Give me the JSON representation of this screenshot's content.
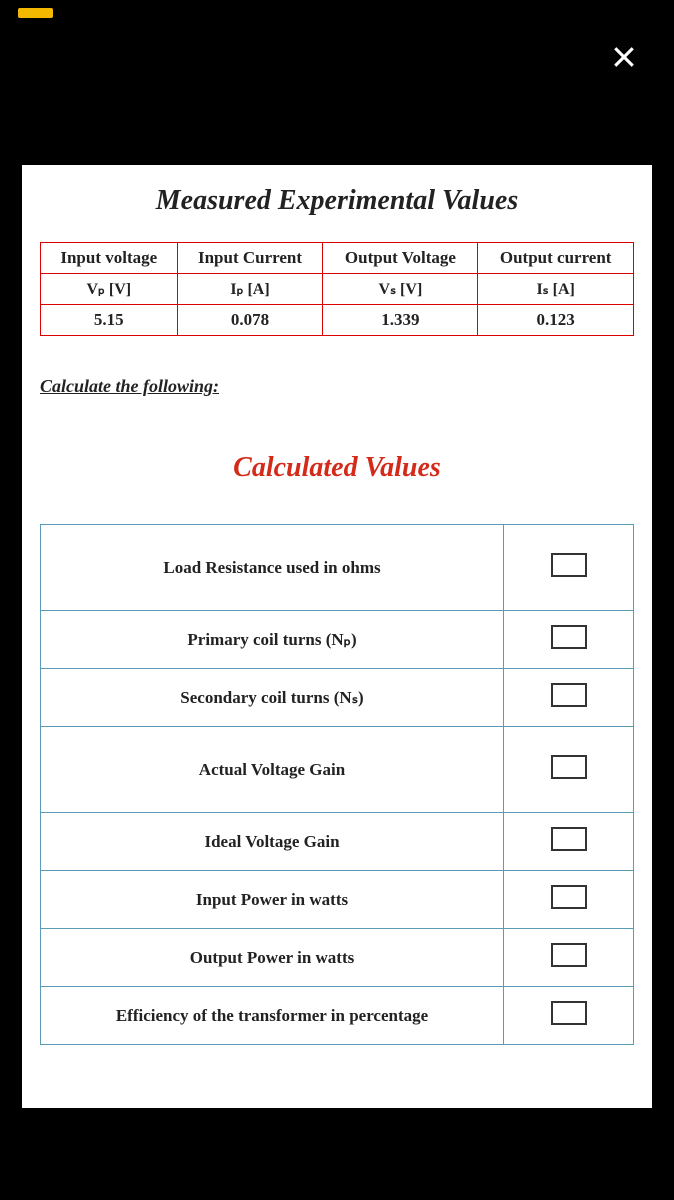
{
  "statusbar": {},
  "close": {
    "label": "close"
  },
  "measured": {
    "title": "Measured Experimental Values",
    "headers": [
      "Input voltage",
      "Input Current",
      "Output Voltage",
      "Output current"
    ],
    "subheaders_text": [
      "Vₚ  [V]",
      "Iₚ [A]",
      "Vₛ  [V]",
      "Iₛ [A]"
    ],
    "values": [
      "5.15",
      "0.078",
      "1.339",
      "0.123"
    ]
  },
  "calculate_label": "Calculate the following:",
  "calculated": {
    "title": "Calculated Values",
    "rows": [
      {
        "label": "Load Resistance used in ohms",
        "tall": true
      },
      {
        "label": "Primary coil turns (Nₚ)",
        "tall": false
      },
      {
        "label": "Secondary coil turns (Nₛ)",
        "tall": false
      },
      {
        "label": "Actual Voltage Gain",
        "tall": true
      },
      {
        "label": "Ideal Voltage Gain",
        "tall": false
      },
      {
        "label": "Input Power in watts",
        "tall": false
      },
      {
        "label": "Output Power in watts",
        "tall": false
      },
      {
        "label": "Efficiency of the transformer in percentage",
        "tall": false
      }
    ]
  },
  "chart_data": {
    "type": "table",
    "title": "Measured Experimental Values",
    "columns": [
      "Input voltage Vₚ [V]",
      "Input Current Iₚ [A]",
      "Output Voltage Vₛ [V]",
      "Output current Iₛ [A]"
    ],
    "rows": [
      [
        5.15,
        0.078,
        1.339,
        0.123
      ]
    ]
  }
}
